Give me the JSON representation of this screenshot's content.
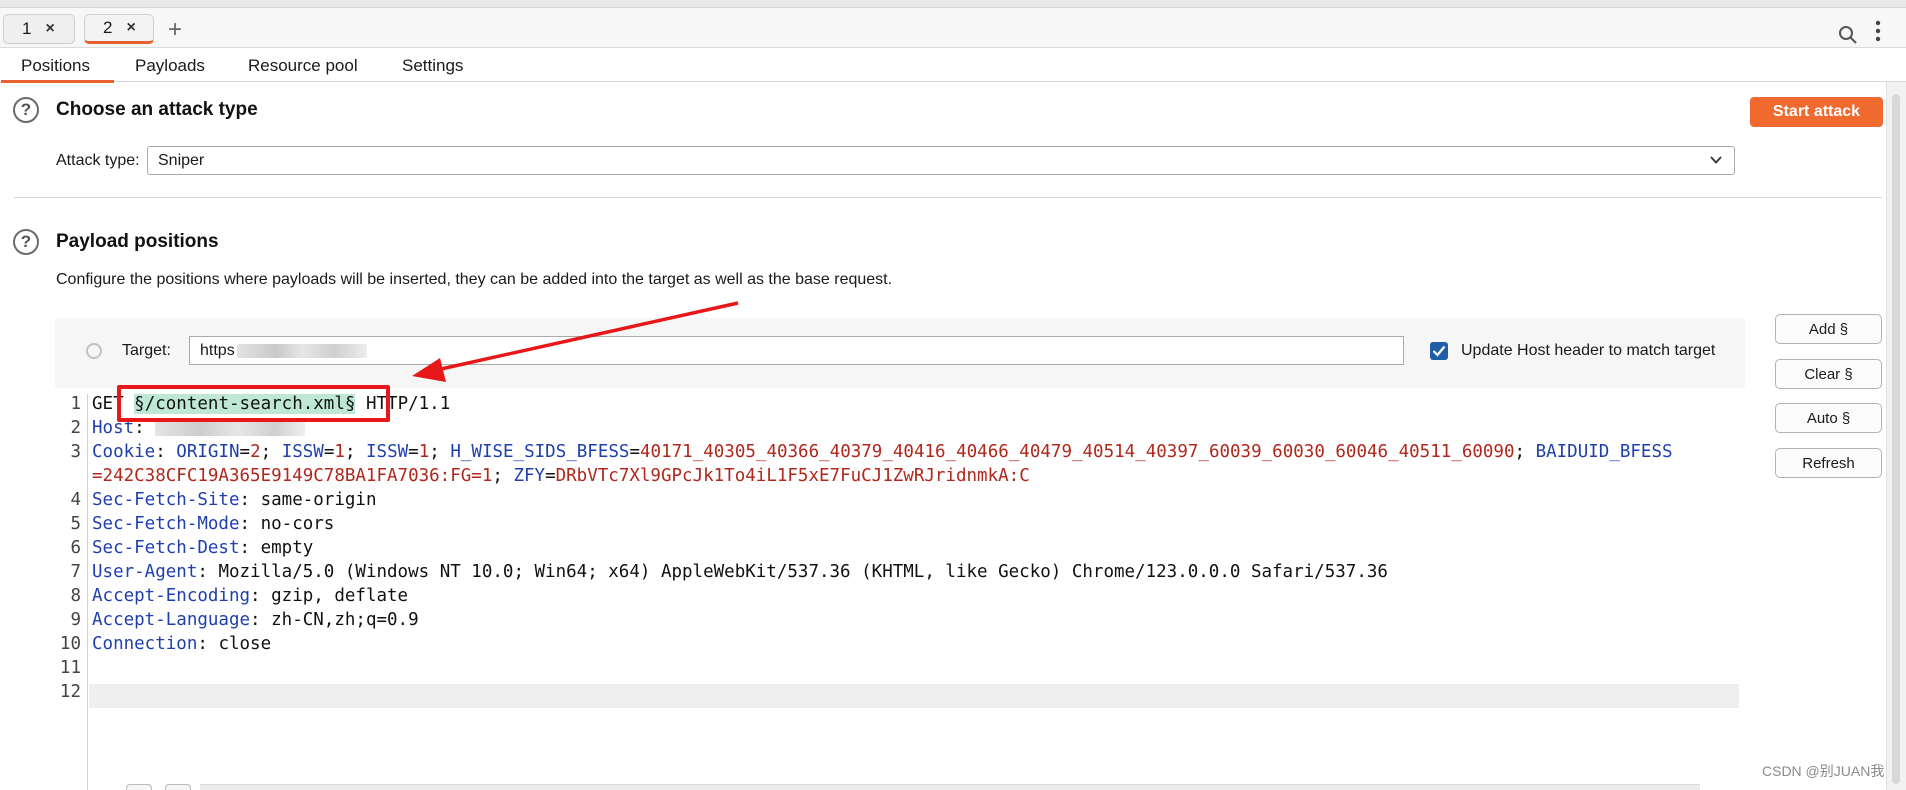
{
  "tabs": {
    "items": [
      {
        "label": "1",
        "close": "×"
      },
      {
        "label": "2",
        "close": "×"
      }
    ],
    "add": "+"
  },
  "subtabs": [
    "Positions",
    "Payloads",
    "Resource pool",
    "Settings"
  ],
  "attack": {
    "title": "Choose an attack type",
    "type_label": "Attack type:",
    "type_value": "Sniper",
    "start_button": "Start attack"
  },
  "payload": {
    "title": "Payload positions",
    "description": "Configure the positions where payloads will be inserted, they can be added into the target as well as the base request.",
    "target_label": "Target:",
    "target_value": "https",
    "update_host_label": "Update Host header to match target",
    "update_host_checked": true
  },
  "side_buttons": [
    "Add §",
    "Clear §",
    "Auto §",
    "Refresh"
  ],
  "request": {
    "line_numbers": [
      "1",
      "2",
      "3",
      "",
      "4",
      "5",
      "6",
      "7",
      "8",
      "9",
      "10",
      "11",
      "12"
    ],
    "l1_method": "GET ",
    "l1_payload": "§/content-search.xml§",
    "l1_proto": " HTTP/1.1",
    "l2_key": "Host",
    "l2_sep": ": ",
    "l3_key": "Cookie",
    "l3_a_key": "ORIGIN",
    "l3_a_val": "2",
    "l3_b_key": "ISSW",
    "l3_b_val": "1",
    "l3_c_key": "ISSW",
    "l3_c_val": "1",
    "l3_d_key": "H_WISE_SIDS_BFESS",
    "l3_d_val": "40171_40305_40366_40379_40416_40466_40479_40514_40397_60039_60030_60046_40511_60090",
    "l3_e_key": "BAIDUID_BFESS",
    "l3_e_val": "=242C38CFC19A365E9149C78BA1FA7036:FG=1",
    "l3_f_key": "ZFY",
    "l3_f_val": "DRbVTc7Xl9GPcJk1To4iL1F5xE7FuCJ1ZwRJridnmkA:C",
    "headers": [
      {
        "key": "Sec-Fetch-Site",
        "val": "same-origin"
      },
      {
        "key": "Sec-Fetch-Mode",
        "val": "no-cors"
      },
      {
        "key": "Sec-Fetch-Dest",
        "val": "empty"
      },
      {
        "key": "User-Agent",
        "val": "Mozilla/5.0 (Windows NT 10.0; Win64; x64) AppleWebKit/537.36 (KHTML, like Gecko) Chrome/123.0.0.0 Safari/537.36"
      },
      {
        "key": "Accept-Encoding",
        "val": "gzip, deflate"
      },
      {
        "key": "Accept-Language",
        "val": "zh-CN,zh;q=0.9"
      },
      {
        "key": "Connection",
        "val": "close"
      }
    ]
  },
  "watermark": "CSDN @别JUAN我",
  "colors": {
    "accent": "#f06a30",
    "header_key": "#1f3fae",
    "header_value": "#b0271c",
    "payload_highlight": "#bfe7d6",
    "annotation_red": "#e8181a"
  },
  "icons": [
    "search-icon",
    "more-vertical-icon",
    "help-icon",
    "chevron-down-icon",
    "target-icon",
    "checkbox-checked-icon"
  ]
}
